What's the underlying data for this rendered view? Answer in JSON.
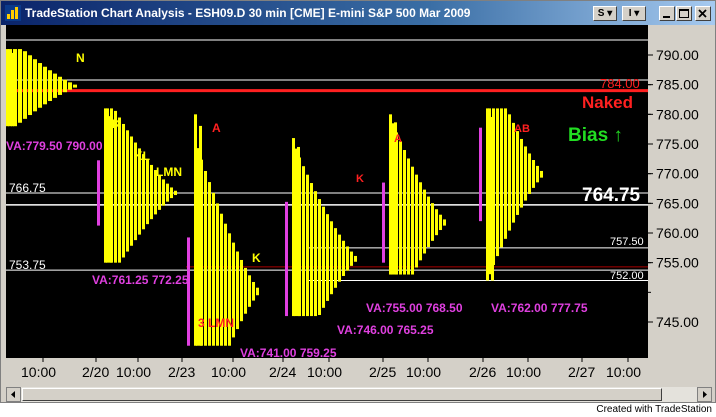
{
  "window": {
    "title": "TradeStation Chart Analysis - ESH09.D  30 min  [CME] E-mini S&P 500 Mar 2009",
    "btn_s": "S",
    "btn_i": "I"
  },
  "icons": [
    "tradestation-app-icon",
    "minimize-icon",
    "maximize-icon",
    "close-icon",
    "scroll-left-icon",
    "scroll-right-icon"
  ],
  "colors": {
    "background": "#000000",
    "profile": "#ffff00",
    "value_area": "#e040e0",
    "naked_level": "#ff2020",
    "bias": "#22dd22",
    "level_line": "#ffffff"
  },
  "price_axis": {
    "ticks": [
      "790.00",
      "785.00",
      "780.00",
      "775.00",
      "770.00",
      "765.00",
      "760.00",
      "755.00",
      "745.00"
    ],
    "current_price": "764.75"
  },
  "time_axis": {
    "labels": [
      "10:00",
      "2/20",
      "10:00",
      "2/23",
      "10:00",
      "2/24",
      "10:00",
      "2/25",
      "10:00",
      "2/26",
      "10:00",
      "2/27",
      "10:00"
    ]
  },
  "annotations": {
    "naked_price": "784.00",
    "naked_label": "Naked",
    "bias_label": "Bias ↑",
    "level_766": "766.75",
    "level_753": "753.75",
    "level_757": "757.50",
    "level_752": "752.00"
  },
  "value_areas": {
    "d1": "VA:779.50 790.00",
    "d2": "VA:761.25 772.25",
    "d3": "VA:741.00 759.25",
    "d4": "VA:746.00 765.25",
    "d5": "VA:755.00 768.50",
    "d6": "VA:762.00 777.75"
  },
  "letters": {
    "d1": "N",
    "d2a": "KL",
    "d2b": "LMN",
    "d2c": "K",
    "d3a": "A",
    "d3b": "3 LMN",
    "d3c": "K",
    "d4": "K",
    "d5": "A",
    "d6": "AB"
  },
  "credit": "Created with TradeStation",
  "chart_data": {
    "type": "market-profile",
    "title": "TradeStation Chart Analysis - ESH09.D  30 min  [CME] E-mini S&P 500 Mar 2009",
    "symbol": "ESH09.D",
    "interval": "30 min",
    "ylim": [
      741,
      792
    ],
    "x_labels": [
      "10:00",
      "2/20",
      "10:00",
      "2/23",
      "10:00",
      "2/24",
      "10:00",
      "2/25",
      "10:00",
      "2/26",
      "10:00",
      "2/27",
      "10:00"
    ],
    "sessions": [
      {
        "session_index": 0,
        "high": 791,
        "low": 778,
        "va_low": 779.5,
        "va_high": 790.0
      },
      {
        "session_index": 1,
        "high": 781,
        "low": 755,
        "va_low": 761.25,
        "va_high": 772.25
      },
      {
        "session_index": 2,
        "high": 780,
        "low": 741,
        "va_low": 741.0,
        "va_high": 759.25
      },
      {
        "session_index": 3,
        "high": 776,
        "low": 746,
        "va_low": 746.0,
        "va_high": 765.25
      },
      {
        "session_index": 4,
        "high": 780,
        "low": 753,
        "va_low": 755.0,
        "va_high": 768.5
      },
      {
        "session_index": 5,
        "high": 781,
        "low": 752,
        "va_low": 762.0,
        "va_high": 777.75
      }
    ],
    "levels": [
      {
        "price": 784.0,
        "name": "Naked"
      },
      {
        "price": 766.75
      },
      {
        "price": 753.75
      },
      {
        "price": 757.5
      },
      {
        "price": 752.0
      }
    ],
    "last_price": 764.75,
    "legend": "none"
  }
}
